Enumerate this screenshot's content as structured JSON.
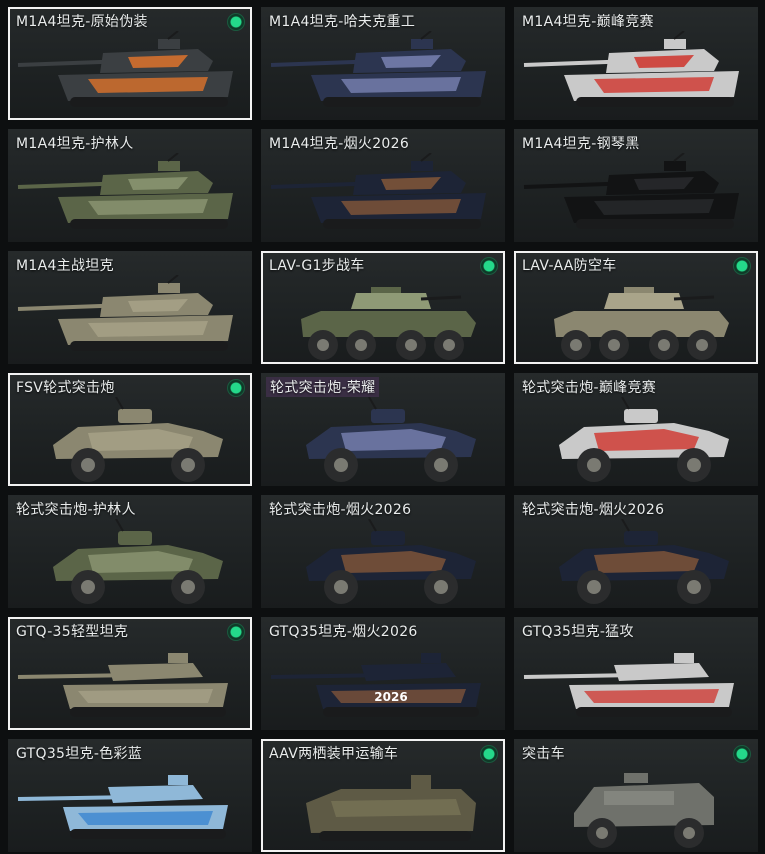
{
  "cards": [
    {
      "label": "M1A4坦克-原始伪装",
      "type": "tank",
      "owned": true,
      "selected": true,
      "paint": "orange"
    },
    {
      "label": "M1A4坦克-哈夫克重工",
      "type": "tank",
      "owned": false,
      "selected": false,
      "paint": "blue"
    },
    {
      "label": "M1A4坦克-巅峰竞赛",
      "type": "tank",
      "owned": false,
      "selected": false,
      "paint": "red"
    },
    {
      "label": "M1A4坦克-护林人",
      "type": "tank",
      "owned": false,
      "selected": false,
      "paint": "green"
    },
    {
      "label": "M1A4坦克-烟火2026",
      "type": "tank",
      "owned": false,
      "selected": false,
      "paint": "navy"
    },
    {
      "label": "M1A4坦克-钢琴黑",
      "type": "tank",
      "owned": false,
      "selected": false,
      "paint": "black"
    },
    {
      "label": "M1A4主战坦克",
      "type": "tank",
      "owned": false,
      "selected": false,
      "paint": "tan"
    },
    {
      "label": "LAV-G1步战车",
      "type": "apc",
      "owned": true,
      "selected": true,
      "paint": "green"
    },
    {
      "label": "LAV-AA防空车",
      "type": "apc",
      "owned": true,
      "selected": true,
      "paint": "tan"
    },
    {
      "label": "FSV轮式突击炮",
      "type": "wheeled",
      "owned": true,
      "selected": true,
      "paint": "tan"
    },
    {
      "label": "轮式突击炮-荣耀",
      "type": "wheeled",
      "owned": false,
      "selected": false,
      "paint": "blue",
      "highlight": true
    },
    {
      "label": "轮式突击炮-巅峰竞赛",
      "type": "wheeled",
      "owned": false,
      "selected": false,
      "paint": "red"
    },
    {
      "label": "轮式突击炮-护林人",
      "type": "wheeled",
      "owned": false,
      "selected": false,
      "paint": "green"
    },
    {
      "label": "轮式突击炮-烟火2026",
      "type": "wheeled",
      "owned": false,
      "selected": false,
      "paint": "navy"
    },
    {
      "label": "轮式突击炮-烟火2026",
      "type": "wheeled",
      "owned": false,
      "selected": false,
      "paint": "navy"
    },
    {
      "label": "GTQ-35轻型坦克",
      "type": "light",
      "owned": true,
      "selected": true,
      "paint": "tan"
    },
    {
      "label": "GTQ35坦克-烟火2026",
      "type": "light",
      "owned": false,
      "selected": false,
      "paint": "navy",
      "decal": "2026"
    },
    {
      "label": "GTQ35坦克-猛攻",
      "type": "light",
      "owned": false,
      "selected": false,
      "paint": "red"
    },
    {
      "label": "GTQ35坦克-色彩蓝",
      "type": "light",
      "owned": false,
      "selected": false,
      "paint": "skyblue"
    },
    {
      "label": "AAV两栖装甲运输车",
      "type": "amphib",
      "owned": true,
      "selected": true,
      "paint": "olive"
    },
    {
      "label": "突击车",
      "type": "mrap",
      "owned": true,
      "selected": false,
      "paint": "gray"
    }
  ],
  "colors": {
    "orange": [
      "#3b3f42",
      "#e8772a"
    ],
    "blue": [
      "#2c3550",
      "#7e87b8"
    ],
    "red": [
      "#c9c9c9",
      "#d02a22"
    ],
    "green": [
      "#5b6548",
      "#8f9a76"
    ],
    "navy": [
      "#1d2436",
      "#8a5a3a"
    ],
    "black": [
      "#121314",
      "#2a2c2e"
    ],
    "tan": [
      "#8b8770",
      "#a9a48a"
    ],
    "olive": [
      "#5e5a45",
      "#7b7659"
    ],
    "gray": [
      "#6f716b",
      "#8c8e86"
    ],
    "skyblue": [
      "#8fb8d8",
      "#2f7fd0"
    ],
    "status": "#24d98a",
    "selected_border": "#f2f2f2"
  }
}
